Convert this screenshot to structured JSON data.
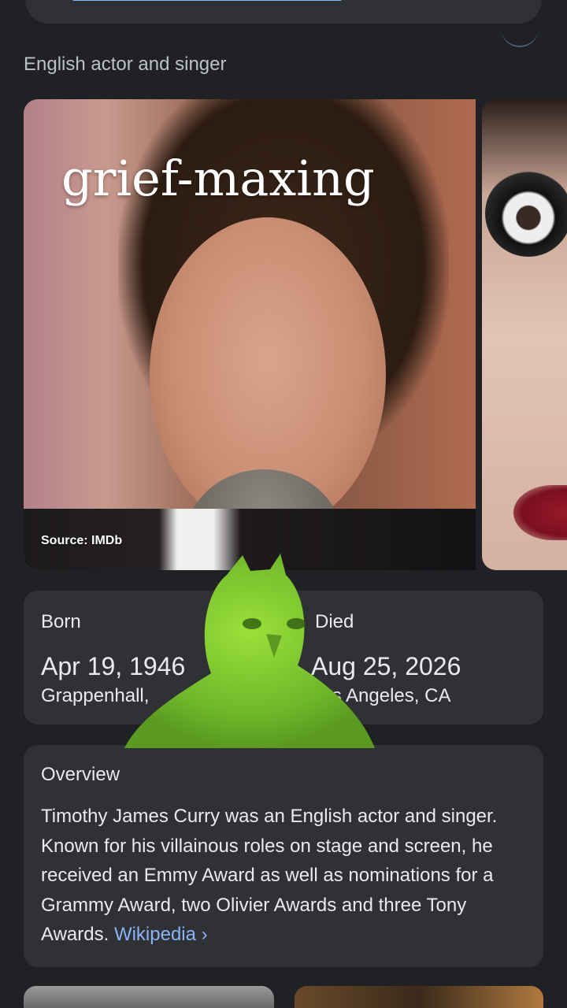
{
  "header": {
    "subtitle": "English actor and singer"
  },
  "images": {
    "overlay_text": "grief-maxing",
    "source_label": "Source: IMDb"
  },
  "facts": {
    "born_label": "Born",
    "born_date": "Apr 19, 1946",
    "born_place": "Grappenhall,",
    "died_label": "Died",
    "died_date": "Aug 25, 2026",
    "died_place": "Los Angeles, CA"
  },
  "overview": {
    "title": "Overview",
    "text": "Timothy James Curry was an English actor and singer. Known for his villainous roles on stage and screen, he received an Emmy Award as well as nominations for a Grammy Award, two Olivier Awards and three Tony Awards.",
    "link_label": "Wikipedia ›"
  },
  "colors": {
    "background": "#202124",
    "card": "#303134",
    "link": "#8ab4f8",
    "sticker_green": "#7dc42c"
  },
  "icons": {
    "sticker": "green-cat-bird-sticker"
  }
}
